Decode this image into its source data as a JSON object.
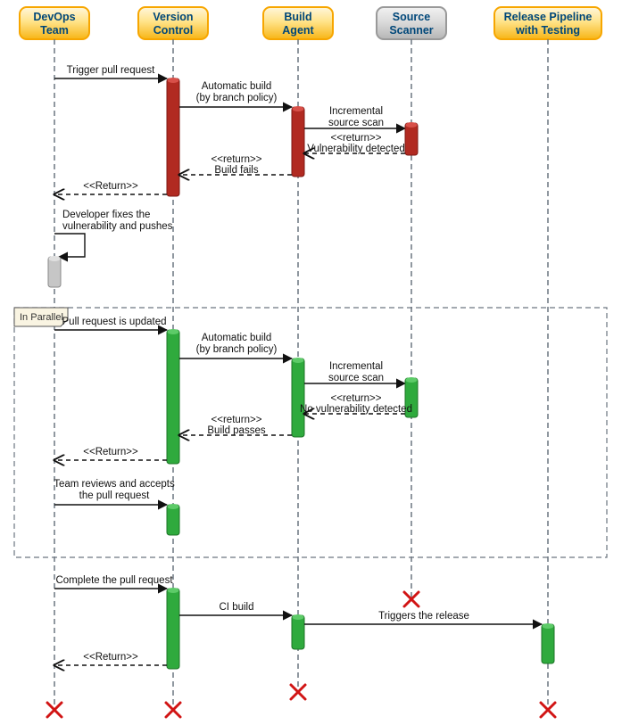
{
  "diagram_type": "uml-sequence",
  "lanes": [
    {
      "id": "devops",
      "label1": "DevOps",
      "label2": "Team",
      "style": "yellow"
    },
    {
      "id": "vc",
      "label1": "Version",
      "label2": "Control",
      "style": "yellow"
    },
    {
      "id": "build",
      "label1": "Build",
      "label2": "Agent",
      "style": "yellow"
    },
    {
      "id": "scan",
      "label1": "Source",
      "label2": "Scanner",
      "style": "grey"
    },
    {
      "id": "rel",
      "label1": "Release Pipeline",
      "label2": "with Testing",
      "style": "yellow"
    }
  ],
  "frame": {
    "label": "In Parallel"
  },
  "messages": {
    "m1": "Trigger pull request",
    "m2a": "Automatic build",
    "m2b": "(by branch policy)",
    "m3a": "Incremental",
    "m3b": "source scan",
    "m4a": "<<return>>",
    "m4b": "Vulnerability detected",
    "m5a": "<<return>>",
    "m5b": "Build fails",
    "m6": "<<Return>>",
    "m7a": "Developer fixes the",
    "m7b": "vulnerability and pushes",
    "m8": "Pull request is updated",
    "m9a": "Automatic build",
    "m9b": "(by branch policy)",
    "m10a": "Incremental",
    "m10b": "source scan",
    "m11a": "<<return>>",
    "m11b": "No vulnerability detected",
    "m12a": "<<return>>",
    "m12b": "Build passes",
    "m13": "<<Return>>",
    "m14a": "Team reviews and accepts",
    "m14b": "the pull request",
    "m15": "Complete the pull request",
    "m16": "CI build",
    "m17": "Triggers the release",
    "m18": "<<Return>>"
  }
}
